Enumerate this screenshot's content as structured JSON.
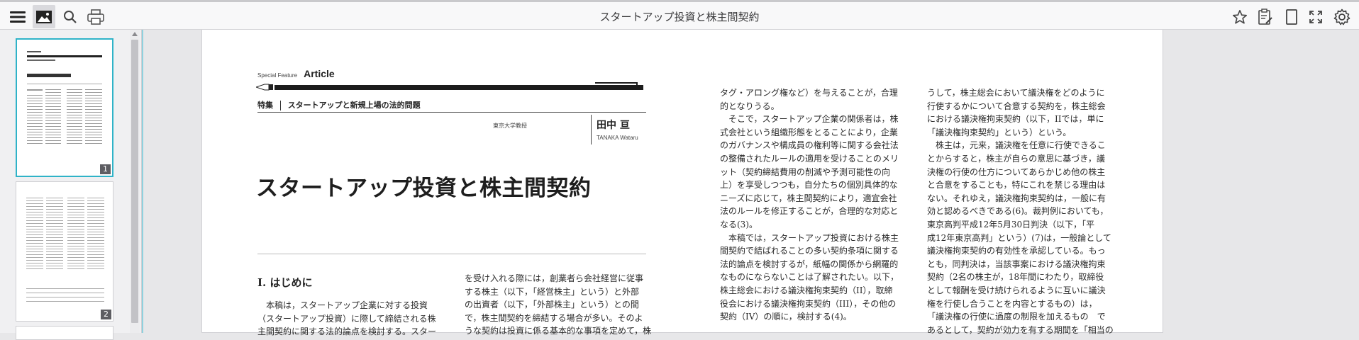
{
  "toolbar": {
    "title": "スタートアップ投資と株主間契約",
    "icons": [
      "menu-icon",
      "image-icon",
      "search-icon",
      "print-icon",
      "star-icon",
      "clipboard-edit-icon",
      "page-icon",
      "fullscreen-icon",
      "gear-icon"
    ]
  },
  "thumbnails": [
    {
      "page": "1"
    },
    {
      "page": "2"
    }
  ],
  "article": {
    "special_feature": "Special Feature",
    "article_word": "Article",
    "tokushu": "特集",
    "tokushu_title": "スタートアップと新規上場の法的問題",
    "affiliation": "東京大学教授",
    "author_jp": "田中 亘",
    "author_en": "TANAKA Wataru",
    "main_title": "スタートアップ投資と株主間契約",
    "section_heading": "I. はじめに",
    "col1": [
      "本稿は，スタートアップ企業に対する投資",
      "（スタートアップ投資）に際して締結される株",
      "主間契約に関する法的論点を検討する。スター"
    ],
    "col2": [
      "を受け入れる際には，創業者ら会社経営に従事",
      "する株主（以下，「経営株主」という）と外部",
      "の出資者（以下，「外部株主」という）との間",
      "で，株主間契約を締結する場合が多い。そのよ",
      "うな契約は投資に係る基本的な事項を定めて，株"
    ],
    "col3": [
      "タグ・アロング権など）を与えることが，合理",
      "的となりうる。",
      "　そこで，スタートアップ企業の関係者は，株",
      "式会社という組織形態をとることにより，企業",
      "のガバナンスや構成員の権利等に関する会社法",
      "の整備されたルールの適用を受けることのメリ",
      "ット（契約締結費用の削減や予測可能性の向",
      "上）を享受しつつも，自分たちの個別具体的な",
      "ニーズに応じて，株主間契約により，適宜会社",
      "法のルールを修正することが，合理的な対応と",
      "なる(3)。",
      "　本稿では，スタートアップ投資における株主",
      "間契約で結ばれることの多い契約条項に関する",
      "法的論点を検討するが，紙幅の関係から網羅的",
      "なものにならないことは了解されたい。以下，",
      "株主総会における議決権拘束契約（II），取締",
      "役会における議決権拘束契約（III），その他の",
      "契約（IV）の順に，検討する(4)。"
    ],
    "col4": [
      "うして，株主総会において議決権をどのように",
      "行使するかについて合意する契約を，株主総会",
      "における議決権拘束契約（以下，IIでは，単に",
      "「議決権拘束契約」という）という。",
      "　株主は，元来，議決権を任意に行使できるこ",
      "とからすると，株主が自らの意思に基づき，議",
      "決権の行使の仕方についてあらかじめ他の株主",
      "と合意をすることも，特にこれを禁じる理由は",
      "ない。それゆえ，議決権拘束契約は，一般に有",
      "効と認めるべきである(6)。裁判例においても，",
      "東京高判平成12年5月30日判決（以下，「平",
      "成12年東京高判」という）(7)は，一般論として",
      "議決権拘束契約の有効性を承認している。もっ",
      "とも，同判決は，当該事案における議決権拘束",
      "契約（2名の株主が，18年間にわたり，取締役",
      "として報酬を受け続けられるように互いに議決",
      "権を行使し合うことを内容とするもの）は，",
      "「議決権の行使に過度の制限を加えるもの　で",
      "あるとして，契約が効力を有する期間を「相当の"
    ]
  }
}
